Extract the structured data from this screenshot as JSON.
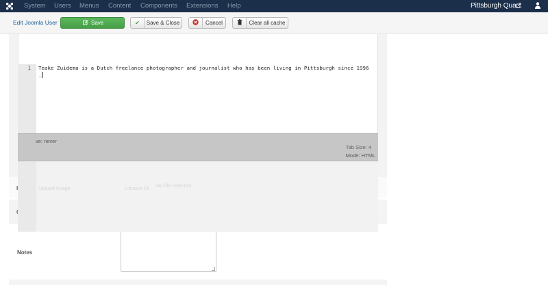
{
  "navbar": {
    "logo_icon": "joomla-logo-icon",
    "items": [
      "System",
      "Users",
      "Menus",
      "Content",
      "Components",
      "Extensions",
      "Help"
    ],
    "site_name": "Pittsburgh Qua...",
    "external_icon": "external-link-icon",
    "user_icon": "user-icon"
  },
  "toolbar": {
    "title": "Edit Joomla User",
    "save_label": "Save",
    "save_close_label": "Save & Close",
    "cancel_label": "Cancel",
    "clear_cache_label": "Clear all cache"
  },
  "editor": {
    "line_number": "1",
    "line_text": "Teake Zuidema is a Dutch freelance photographer and journalist who has been living in Pittsburgh since 1996",
    "line_continuation": ".",
    "status_left": "ve: never",
    "tab_size": "Tab Size: 4",
    "mode": "Mode: HTML"
  },
  "form": {
    "notes_label": "Notes",
    "ghost_field_1": "Upload Image",
    "ghost_field_2": "Choose Fil",
    "ghost_field_3": "No file selected"
  },
  "colors": {
    "navbar_bg": "#1b2f4a",
    "save_green": "#5cb85c",
    "link_blue": "#1f5e99",
    "cancel_red": "#c9302c"
  }
}
